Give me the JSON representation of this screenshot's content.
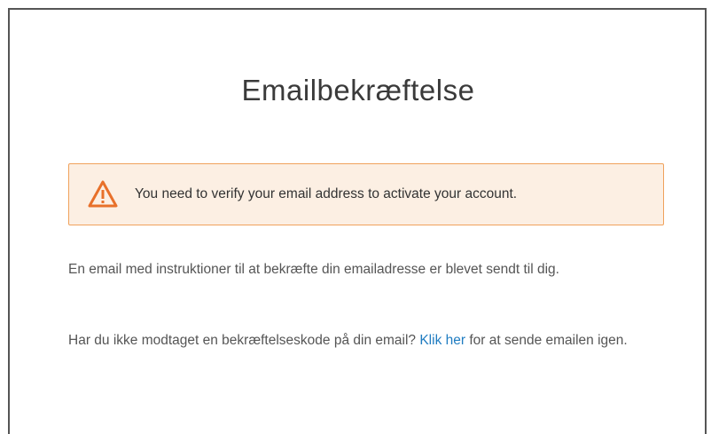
{
  "page": {
    "title": "Emailbekræftelse"
  },
  "alert": {
    "icon": "warning-triangle-icon",
    "message": "You need to verify your email address to activate your account.",
    "color": "#f0a25c",
    "background": "#fcefe3"
  },
  "instructions": {
    "sent_text": "En email med instruktioner til at bekræfte din emailadresse er blevet sendt til dig.",
    "resend_prefix": "Har du ikke modtaget en bekræftelseskode på din email? ",
    "resend_link": "Klik her",
    "resend_suffix": " for at sende emailen igen.",
    "link_color": "#1f7cc1"
  }
}
